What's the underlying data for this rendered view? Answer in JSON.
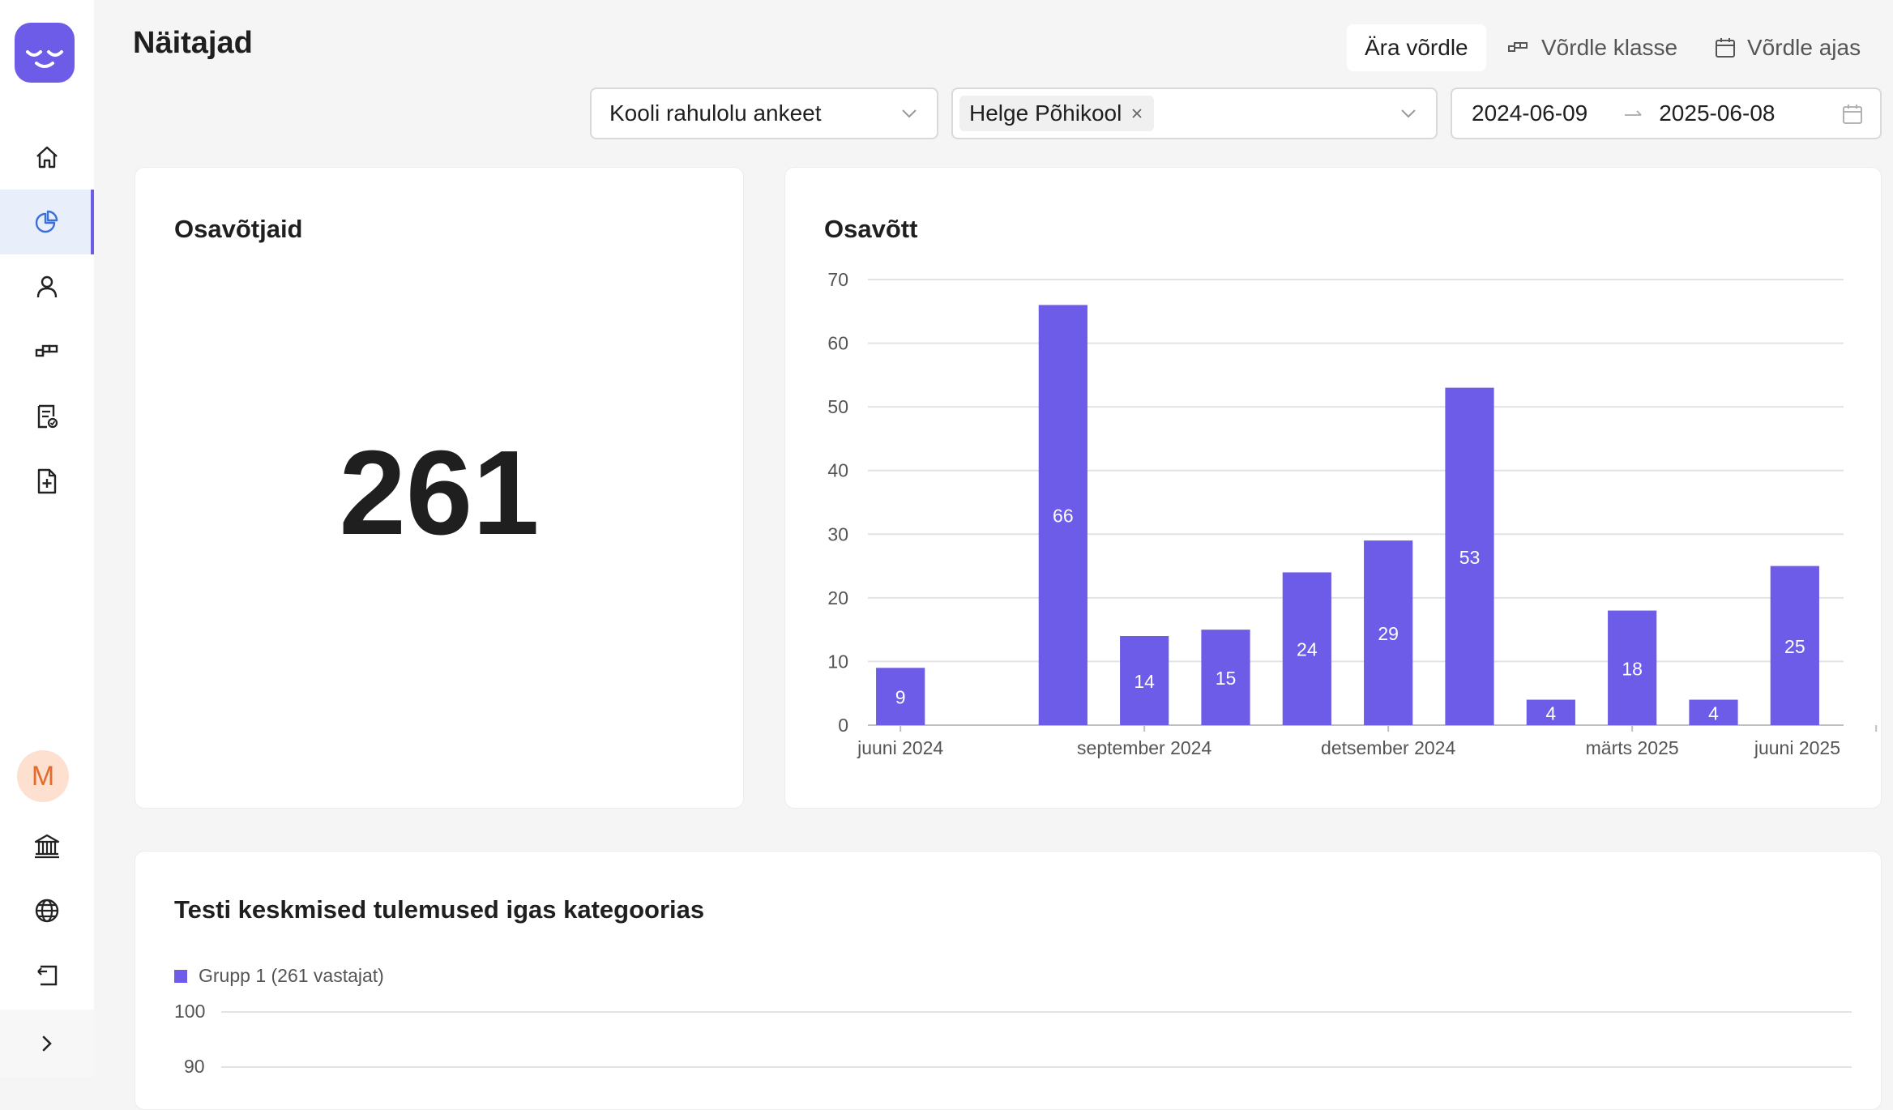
{
  "page": {
    "title": "Näitajad"
  },
  "header": {
    "compare_options": [
      "Ära võrdle",
      "Võrdle klasse",
      "Võrdle ajas"
    ],
    "survey_select": "Kooli rahulolu ankeet",
    "school_tag": "Helge Põhikool",
    "date_from": "2024-06-09",
    "date_to": "2025-06-08"
  },
  "sidebar": {
    "avatar_letter": "M",
    "items": [
      {
        "name": "home-icon"
      },
      {
        "name": "chart-icon",
        "active": true
      },
      {
        "name": "user-icon"
      },
      {
        "name": "classes-icon"
      },
      {
        "name": "survey-icon"
      },
      {
        "name": "new-document-icon"
      },
      {
        "name": "institution-icon"
      },
      {
        "name": "globe-icon"
      },
      {
        "name": "logout-icon"
      }
    ],
    "accent": "#6c5ce7"
  },
  "participants_card": {
    "title": "Osavõtjaid",
    "count": "261"
  },
  "participation_card": {
    "title": "Osavõtt"
  },
  "results_card": {
    "title": "Testi keskmised tulemused igas kategoorias",
    "legend": "Grupp 1 (261 vastajat)",
    "y_ticks_visible": [
      "100",
      "90"
    ]
  },
  "chart_data": {
    "type": "bar",
    "title": "Osavõtt",
    "x_tick_labels": [
      "juuni 2024",
      "september 2024",
      "detsember 2024",
      "märts 2025",
      "juuni 2025"
    ],
    "categories": [
      "2024-06",
      "2024-07",
      "2024-08",
      "2024-09",
      "2024-10",
      "2024-11",
      "2024-12",
      "2025-01",
      "2025-02",
      "2025-03",
      "2025-04",
      "2025-05"
    ],
    "values": [
      9,
      0,
      66,
      14,
      15,
      24,
      29,
      53,
      4,
      18,
      4,
      25
    ],
    "ylim": [
      0,
      70
    ],
    "y_ticks": [
      0,
      10,
      20,
      30,
      40,
      50,
      60,
      70
    ],
    "grid": true,
    "bar_color": "#6c5ce7"
  }
}
